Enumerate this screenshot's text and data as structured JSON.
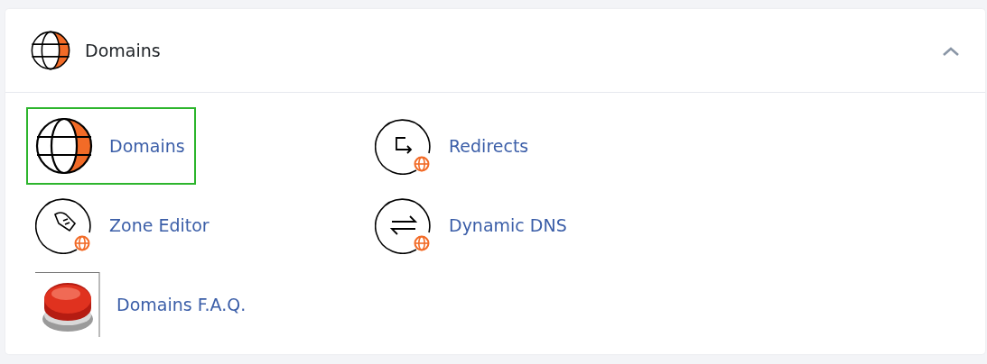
{
  "section": {
    "title": "Domains",
    "expanded": true
  },
  "items": [
    {
      "label": "Domains",
      "kind": "globe",
      "selected": true
    },
    {
      "label": "Redirects",
      "kind": "redirect",
      "selected": false
    },
    {
      "label": "Zone Editor",
      "kind": "zone",
      "selected": false
    },
    {
      "label": "Dynamic DNS",
      "kind": "dns",
      "selected": false
    },
    {
      "label": "Domains F.A.Q.",
      "kind": "help",
      "selected": false
    }
  ]
}
